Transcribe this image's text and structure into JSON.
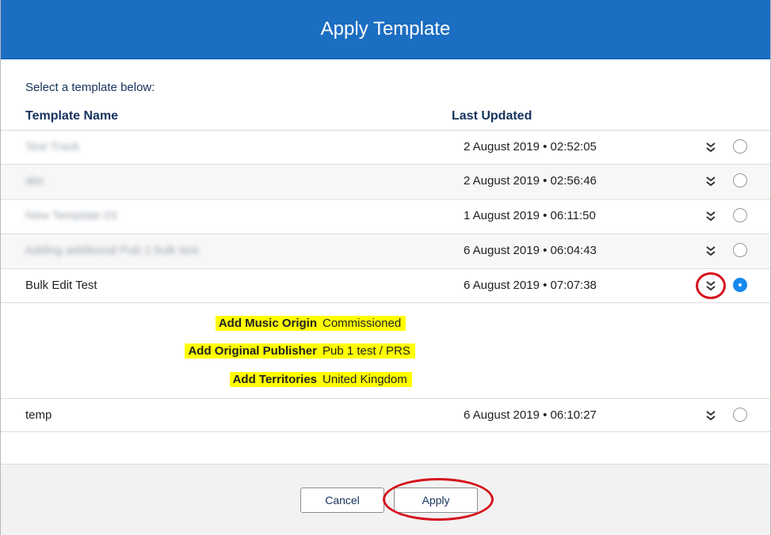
{
  "dialog": {
    "title": "Apply Template"
  },
  "list": {
    "prompt": "Select a template below:",
    "columns": {
      "name": "Template Name",
      "updated": "Last Updated"
    },
    "rows": [
      {
        "name": "Test Track",
        "blurred": true,
        "updated": "2 August 2019 • 02:52:05",
        "selected": false
      },
      {
        "name": "abc",
        "blurred": true,
        "updated": "2 August 2019 • 02:56:46",
        "selected": false
      },
      {
        "name": "New Template 03",
        "blurred": true,
        "updated": "1 August 2019 • 06:11:50",
        "selected": false
      },
      {
        "name": "Adding additional Pub 1 bulk test",
        "blurred": true,
        "updated": "6 August 2019 • 06:04:43",
        "selected": false
      },
      {
        "name": "Bulk Edit Test",
        "blurred": false,
        "updated": "6 August 2019 • 07:07:38",
        "selected": true
      },
      {
        "name": "temp",
        "blurred": false,
        "updated": "6 August 2019 • 06:10:27",
        "selected": false
      }
    ],
    "expanded_details": [
      {
        "label": "Add Music Origin",
        "value": "Commissioned"
      },
      {
        "label": "Add Original Publisher",
        "value": "Pub 1 test / PRS"
      },
      {
        "label": "Add Territories",
        "value": "United Kingdom"
      }
    ]
  },
  "footer": {
    "cancel_label": "Cancel",
    "apply_label": "Apply"
  },
  "colors": {
    "header": "#1b6ec2",
    "highlight": "#ffff00",
    "annotation_ring": "#d4141c",
    "radio_selected": "#1589ee"
  },
  "icons": {
    "expand": "double-chevron-down-icon"
  }
}
